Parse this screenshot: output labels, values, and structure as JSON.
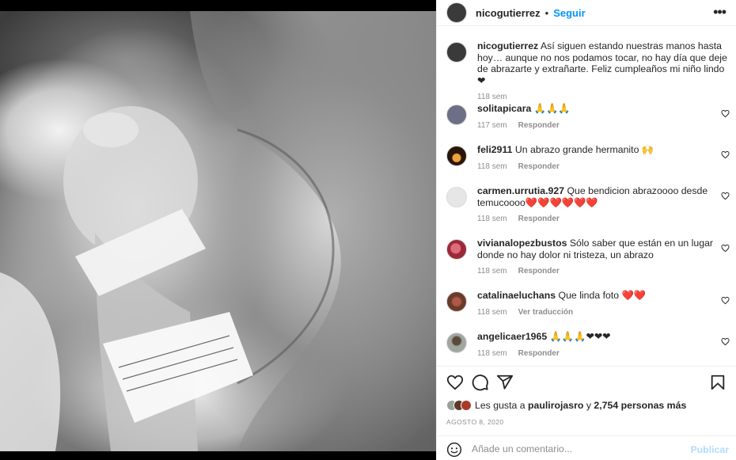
{
  "header": {
    "username": "nicogutierrez",
    "dot": "•",
    "follow": "Seguir",
    "more": "•••"
  },
  "caption": {
    "username": "nicogutierrez",
    "text": "Así siguen estando nuestras manos hasta hoy… aunque no nos podamos tocar, no hay día que deje de abrazarte y extrañarte. Feliz cumpleaños mi niño lindo ❤",
    "time": "118 sem"
  },
  "comments": [
    {
      "username": "solitapicara",
      "text": "🙏🙏🙏",
      "time": "117 sem",
      "action": "Responder",
      "avatar_color": "#6d6f86"
    },
    {
      "username": "feli2911",
      "text": "Un abrazo grande hermanito 🙌",
      "time": "118 sem",
      "action": "Responder",
      "avatar_color": "#2a1608"
    },
    {
      "username": "carmen.urrutia.927",
      "text": "Que bendicion abrazoooo desde temucoooo❤️❤️❤️❤️❤️❤️",
      "time": "118 sem",
      "action": "Responder",
      "avatar_color": "#e6e6e6"
    },
    {
      "username": "vivianalopezbustos",
      "text": "Sólo saber que están en un lugar donde no hay dolor ni tristeza, un abrazo",
      "time": "118 sem",
      "action": "Responder",
      "avatar_color": "#9a2a3a"
    },
    {
      "username": "catalinaeluchans",
      "text": "Que linda foto ❤️❤️",
      "time": "118 sem",
      "action": "Ver traducción",
      "avatar_color": "#6b3b2a"
    },
    {
      "username": "angelicaer1965",
      "text": "🙏🙏🙏❤❤❤",
      "time": "118 sem",
      "action": "Responder",
      "avatar_color": "#a0a7a0"
    }
  ],
  "likes": {
    "prefix": "Les gusta a",
    "user": "paulirojasro",
    "joiner": "y",
    "others": "2,754 personas más"
  },
  "date": "AGOSTO 8, 2020",
  "add_comment": {
    "placeholder": "Añade un comentario...",
    "publish": "Publicar"
  },
  "icons": {
    "more": "more-icon",
    "like": "heart-icon",
    "comment": "comment-icon",
    "share": "share-icon",
    "save": "bookmark-icon",
    "emoji": "emoji-icon"
  },
  "colors": {
    "link": "#0095f6",
    "muted": "#8e8e8e",
    "publish_disabled": "#b3dbff"
  }
}
